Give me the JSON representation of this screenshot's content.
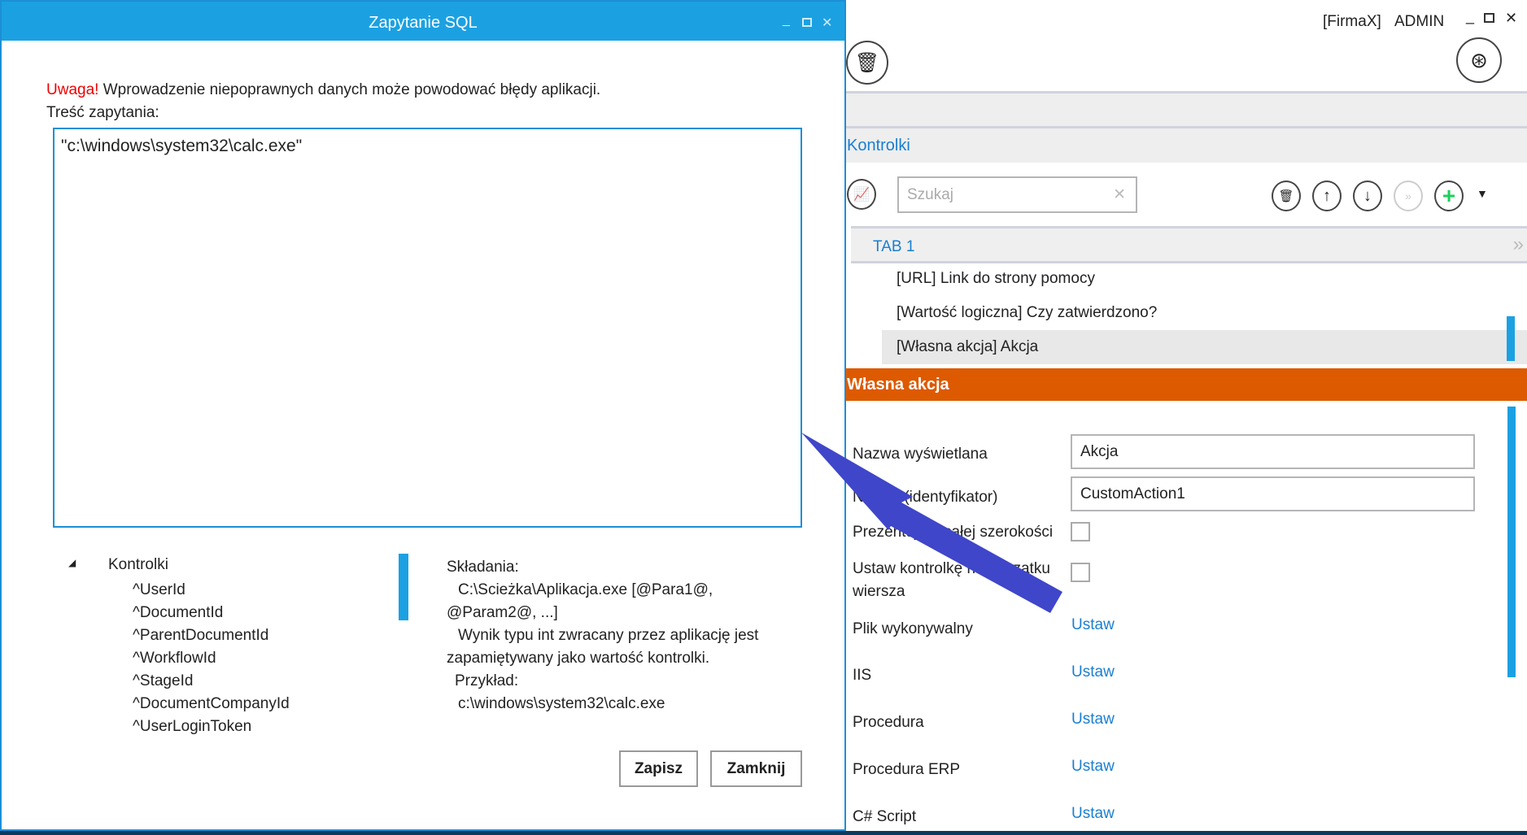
{
  "dialog": {
    "title": "Zapytanie SQL",
    "warning_label": "Uwaga!",
    "warning_text": " Wprowadzenie niepoprawnych danych może powodować błędy aplikacji.",
    "query_label": "Treść zapytania:",
    "query_value": "\"c:\\windows\\system32\\calc.exe\"",
    "tree": {
      "root": "Kontrolki",
      "children": [
        "^UserId",
        "^DocumentId",
        "^ParentDocumentId",
        "^WorkflowId",
        "^StageId",
        "^DocumentCompanyId",
        "^UserLoginToken"
      ]
    },
    "help": [
      "Składania:",
      "C:\\Scieżka\\Aplikacja.exe [@Para1@,",
      "@Param2@, ...]",
      "Wynik typu int zwracany przez aplikację jest",
      "zapamiętywany jako wartość kontrolki.",
      "Przykład:",
      "c:\\windows\\system32\\calc.exe"
    ],
    "save_label": "Zapisz",
    "close_label": "Zamknij"
  },
  "header": {
    "company": "[FirmaX]",
    "user": "ADMIN"
  },
  "controls": {
    "section_title": "Kontrolki",
    "search_placeholder": "Szukaj",
    "tab": "TAB 1",
    "items": [
      "[URL] Link do strony pomocy",
      "[Wartość logiczna] Czy zatwierdzono?",
      "[Własna akcja] Akcja"
    ]
  },
  "props": {
    "title": "Własna akcja",
    "display_name_label": "Nazwa wyświetlana",
    "display_name_value": "Akcja",
    "id_label": "Nazwa (identyfikator)",
    "id_value": "CustomAction1",
    "fullwidth_label": "Prezentuj na całej szerokości",
    "rowstart_label": "Ustaw kontrolkę na początku wiersza",
    "set_label": "Ustaw",
    "links": [
      "Plik wykonywalny",
      "IIS",
      "Procedura",
      "Procedura ERP",
      "C# Script"
    ]
  },
  "colors": {
    "accent": "#1ba1e2",
    "orange": "#dd5a00",
    "arrow": "#3f46c9"
  }
}
